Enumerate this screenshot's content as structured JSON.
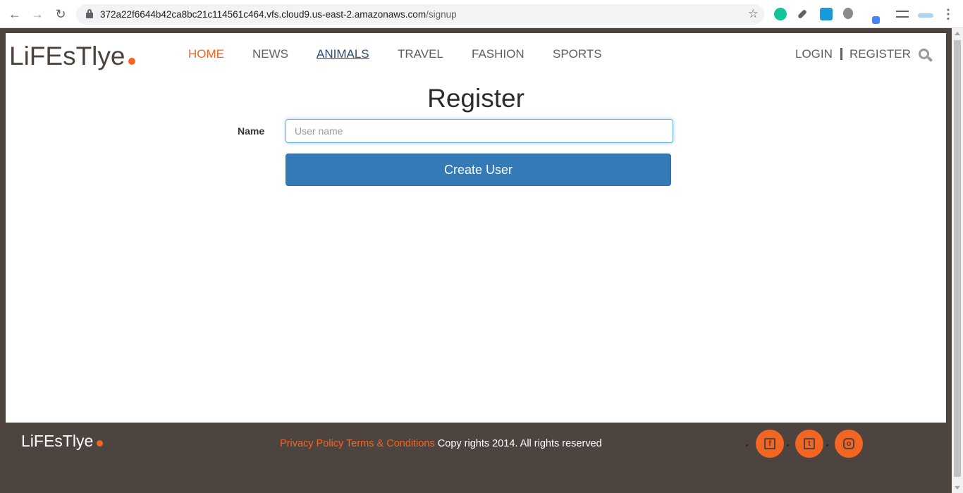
{
  "browser": {
    "url_host": "372a22f6644b42ca8bc21c114561c464.vfs.cloud9.us-east-2.amazonaws.com",
    "url_path": "/signup"
  },
  "header": {
    "logo": "LiFEsTlye",
    "nav": [
      "HOME",
      "NEWS",
      "ANIMALS",
      "TRAVEL",
      "FASHION",
      "SPORTS"
    ],
    "login": "LOGIN",
    "register": "REGISTER"
  },
  "form": {
    "title": "Register",
    "name_label": "Name",
    "name_placeholder": "User name",
    "submit_label": "Create User"
  },
  "footer": {
    "logo": "LiFEsTlye",
    "privacy": "Privacy Policy",
    "terms": "Terms & Conditions",
    "copyright": "Copy rights 2014. All rights reserved",
    "social": [
      {
        "name": "facebook-icon",
        "glyph": "f"
      },
      {
        "name": "twitter-icon",
        "glyph": "t"
      },
      {
        "name": "instagram-icon",
        "glyph": "o"
      }
    ]
  },
  "colors": {
    "accent": "#f26522",
    "brand_dark": "#4d433f",
    "button": "#337ab7"
  }
}
